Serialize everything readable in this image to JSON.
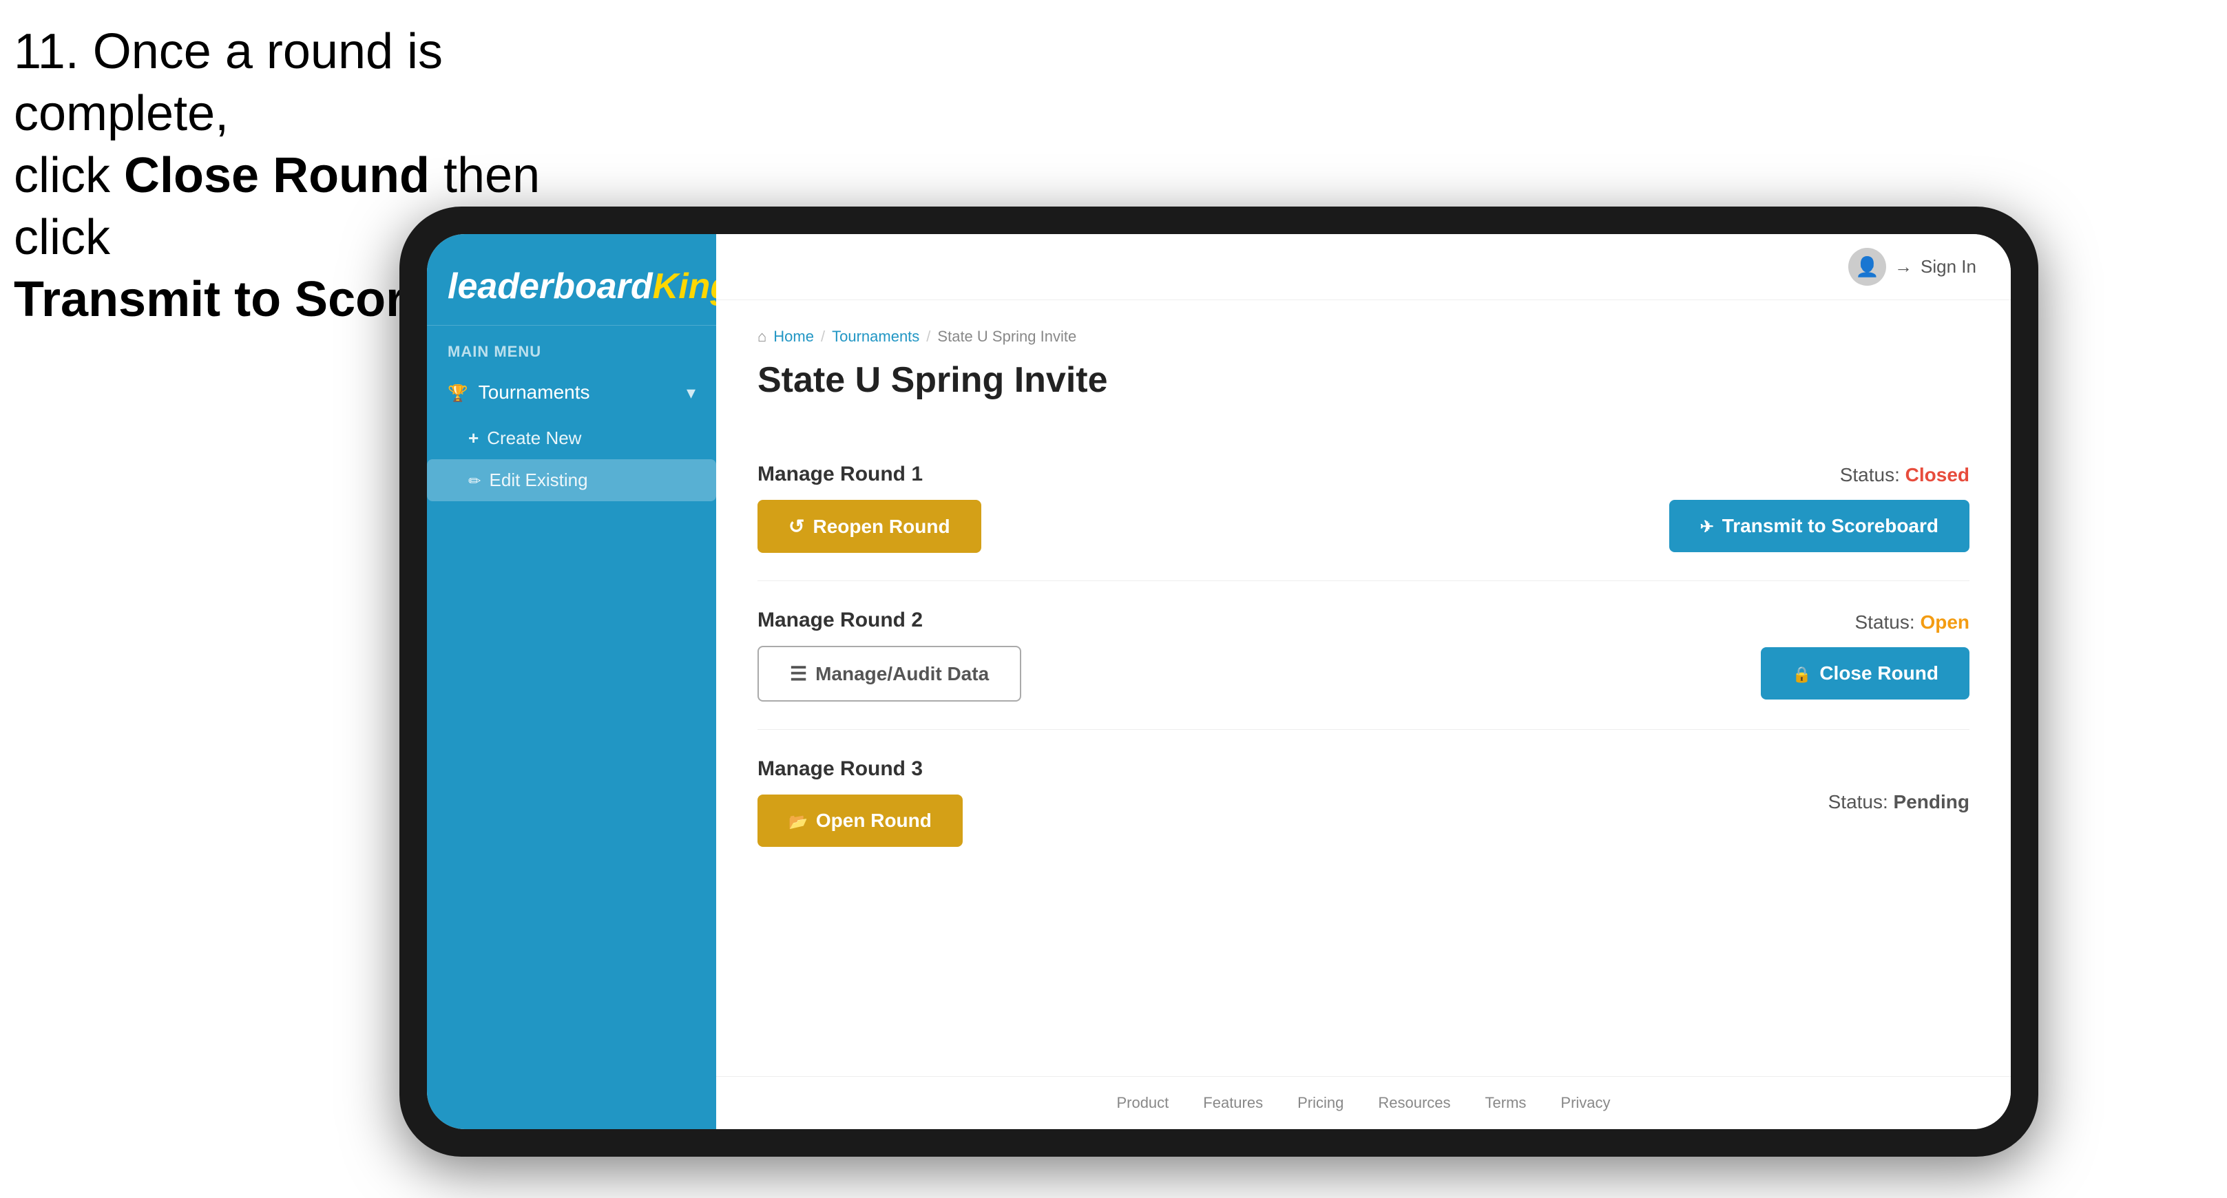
{
  "instruction": {
    "text_line1": "11. Once a round is complete,",
    "text_line2_pre": "click ",
    "text_line2_bold1": "Close Round",
    "text_line2_post": " then click",
    "text_line3": "Transmit to Scoreboard."
  },
  "app": {
    "logo_text": "leaderboard",
    "logo_king": "King",
    "main_menu_label": "MAIN MENU",
    "sidebar_items": [
      {
        "id": "tournaments",
        "label": "Tournaments",
        "icon": "trophy",
        "expanded": true
      },
      {
        "id": "create-new",
        "label": "Create New",
        "icon": "plus",
        "sub": true
      },
      {
        "id": "edit-existing",
        "label": "Edit Existing",
        "icon": "pencil",
        "sub": true,
        "active": true
      }
    ],
    "topbar": {
      "sign_in_label": "Sign In"
    },
    "breadcrumb": {
      "home": "Home",
      "sep1": "/",
      "tournaments": "Tournaments",
      "sep2": "/",
      "current": "State U Spring Invite"
    },
    "page_title": "State U Spring Invite",
    "rounds": [
      {
        "id": "round1",
        "title": "Manage Round 1",
        "status_label": "Status:",
        "status_value": "Closed",
        "status_class": "closed",
        "buttons": [
          {
            "id": "reopen-round",
            "label": "Reopen Round",
            "style": "yellow",
            "icon": "reopen"
          },
          {
            "id": "transmit-scoreboard",
            "label": "Transmit to Scoreboard",
            "style": "blue",
            "icon": "transmit"
          }
        ]
      },
      {
        "id": "round2",
        "title": "Manage Round 2",
        "status_label": "Status:",
        "status_value": "Open",
        "status_class": "open",
        "buttons": [
          {
            "id": "manage-audit",
            "label": "Manage/Audit Data",
            "style": "outline",
            "icon": "audit"
          },
          {
            "id": "close-round",
            "label": "Close Round",
            "style": "blue",
            "icon": "close"
          }
        ]
      },
      {
        "id": "round3",
        "title": "Manage Round 3",
        "status_label": "Status:",
        "status_value": "Pending",
        "status_class": "pending",
        "buttons": [
          {
            "id": "open-round",
            "label": "Open Round",
            "style": "yellow",
            "icon": "open"
          }
        ]
      }
    ],
    "footer_links": [
      "Product",
      "Features",
      "Pricing",
      "Resources",
      "Terms",
      "Privacy"
    ]
  }
}
